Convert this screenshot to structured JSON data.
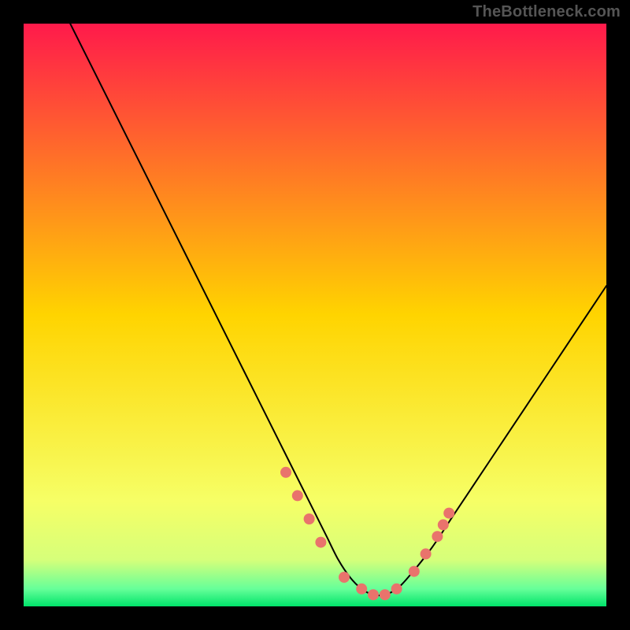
{
  "watermark": {
    "text": "TheBottleneck.com"
  },
  "chart_data": {
    "type": "line",
    "title": "",
    "xlabel": "",
    "ylabel": "",
    "xlim": [
      0,
      100
    ],
    "ylim": [
      0,
      100
    ],
    "background_gradient": {
      "stops": [
        {
          "offset": 0.0,
          "color": "#ff1a4b"
        },
        {
          "offset": 0.5,
          "color": "#ffd400"
        },
        {
          "offset": 0.82,
          "color": "#f6ff66"
        },
        {
          "offset": 0.92,
          "color": "#d6ff7a"
        },
        {
          "offset": 0.97,
          "color": "#66ff99"
        },
        {
          "offset": 1.0,
          "color": "#00e46a"
        }
      ]
    },
    "series": [
      {
        "name": "curve",
        "color": "#000000",
        "x": [
          8,
          12,
          16,
          20,
          24,
          28,
          32,
          36,
          40,
          44,
          48,
          50,
          52,
          54,
          56,
          58,
          60,
          62,
          64,
          66,
          70,
          74,
          78,
          82,
          86,
          90,
          94,
          98,
          100
        ],
        "y": [
          100,
          92,
          84,
          76,
          68,
          60,
          52,
          44,
          36,
          28,
          20,
          16,
          12,
          8,
          5,
          3,
          2,
          2,
          3,
          5,
          10,
          16,
          22,
          28,
          34,
          40,
          46,
          52,
          55
        ]
      }
    ],
    "markers": {
      "name": "highlight-dots",
      "color": "#e9736c",
      "radius": 7,
      "x": [
        45,
        47,
        49,
        51,
        55,
        58,
        60,
        62,
        64,
        67,
        69,
        71,
        72,
        73
      ],
      "y": [
        23,
        19,
        15,
        11,
        5,
        3,
        2,
        2,
        3,
        6,
        9,
        12,
        14,
        16
      ]
    }
  }
}
